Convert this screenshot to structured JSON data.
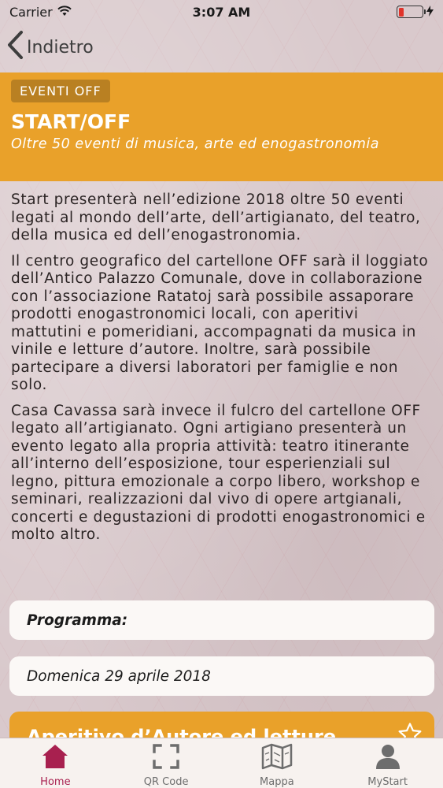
{
  "status_bar": {
    "carrier": "Carrier",
    "time": "3:07 AM"
  },
  "nav": {
    "back_label": "Indietro"
  },
  "header": {
    "category": "EVENTI OFF",
    "title": "START/OFF",
    "subtitle": "Oltre 50 eventi di musica, arte ed enogastronomia"
  },
  "content": {
    "paragraphs": [
      "Start presenterà nell’edizione 2018 oltre 50 eventi legati al mondo dell’arte, dell’artigianato, del teatro, della musica ed dell’enogastronomia.",
      "Il centro geografico del cartellone OFF sarà il loggiato dell’Antico Palazzo Comunale, dove in collaborazione con l’associazione Ratatoj sarà possibile assaporare prodotti enogastronomici locali, con aperitivi mattutini e pomeridiani, accompagnati da musica in vinile e letture d’autore. Inoltre, sarà possibile partecipare a diversi laboratori per famiglie e non solo.",
      "Casa Cavassa sarà invece il fulcro del cartellone OFF legato all’artigianato. Ogni artigiano presenterà un evento legato alla propria attività: teatro itinerante all’interno dell’esposizione, tour esperienziali sul legno, pittura emozionale a corpo libero, workshop e seminari, realizzazioni dal vivo di opere artgianali, concerti e degustazioni di prodotti enogastronomici e molto altro."
    ]
  },
  "program": {
    "label": "Programma:",
    "date": "Domenica 29 aprile 2018",
    "event_title": "Aperitivo d’Autore ed letture"
  },
  "tabs": [
    {
      "label": "Home",
      "icon": "home-icon",
      "active": true
    },
    {
      "label": "QR Code",
      "icon": "qr-code-icon",
      "active": false
    },
    {
      "label": "Mappa",
      "icon": "map-icon",
      "active": false
    },
    {
      "label": "MyStart",
      "icon": "user-icon",
      "active": false
    }
  ],
  "colors": {
    "accent_orange": "#e9a12a",
    "badge_brown": "#b98022",
    "active_tab": "#a8204f",
    "battery_low": "#e0332a"
  }
}
